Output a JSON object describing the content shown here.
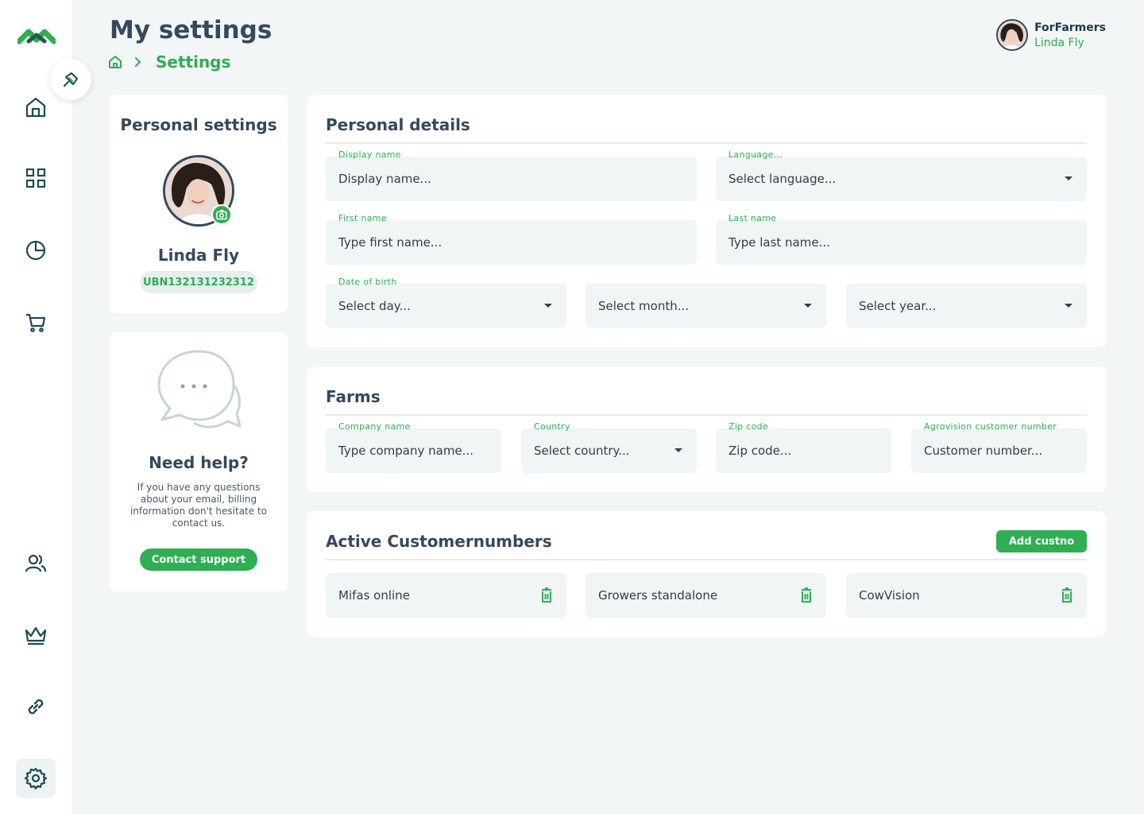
{
  "colors": {
    "brand": "#2fae54",
    "dark": "#34495e",
    "field_bg": "#f1f5f5"
  },
  "sidebar": {
    "logo_icon": "forfarmers-logo",
    "items": [
      {
        "icon": "home-icon"
      },
      {
        "icon": "grid-icon"
      },
      {
        "icon": "pie-chart-icon"
      },
      {
        "icon": "cart-icon"
      },
      {
        "icon": "users-icon"
      },
      {
        "icon": "crown-icon"
      },
      {
        "icon": "link-icon"
      },
      {
        "icon": "gear-icon",
        "active": true
      }
    ],
    "pin_icon": "pin-icon"
  },
  "header": {
    "title": "My settings",
    "breadcrumb": {
      "home_icon": "home-icon",
      "current": "Settings"
    },
    "user": {
      "org": "ForFarmers",
      "name": "Linda Fly"
    }
  },
  "personal_settings": {
    "title": "Personal settings",
    "name": "Linda Fly",
    "ubn": "UBN132131232312"
  },
  "help": {
    "title": "Need help?",
    "text": "If you have any questions about your email, billing information don't hesitate to contact us.",
    "button": "Contact support"
  },
  "personal_details": {
    "title": "Personal details",
    "display_name": {
      "label": "Display name",
      "value": "Display name..."
    },
    "language": {
      "label": "Language...",
      "value": "Select language..."
    },
    "first_name": {
      "label": "First name",
      "value": "Type first name..."
    },
    "last_name": {
      "label": "Last name",
      "value": "Type last name..."
    },
    "dob": {
      "label": "Date of birth",
      "day": "Select day...",
      "month": "Select month...",
      "year": "Select year..."
    }
  },
  "farms": {
    "title": "Farms",
    "company": {
      "label": "Company name",
      "value": "Type company name..."
    },
    "country": {
      "label": "Country",
      "value": "Select country..."
    },
    "zip": {
      "label": "Zip code",
      "value": "Zip code..."
    },
    "agrovision": {
      "label": "Agrovision customer number",
      "value": "Customer number..."
    }
  },
  "customernumbers": {
    "title": "Active Customernumbers",
    "add_button": "Add custno",
    "items": [
      "Mifas online",
      "Growers standalone",
      "CowVision"
    ]
  }
}
